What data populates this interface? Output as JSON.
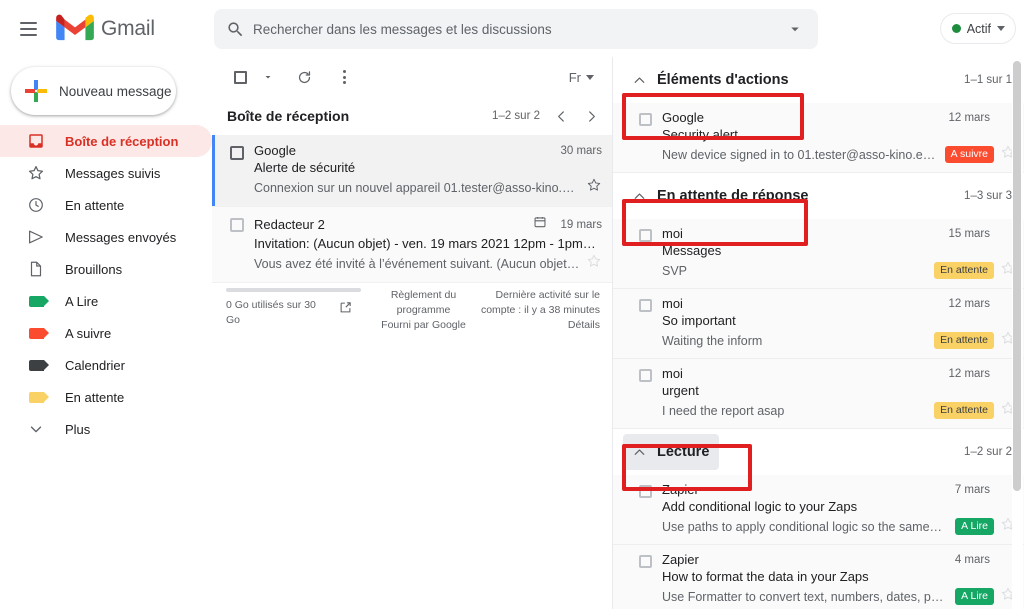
{
  "topbar": {
    "app_name": "Gmail",
    "menu_icon": "hamburger-icon",
    "logo_icon": "gmail-logo-icon",
    "search": {
      "placeholder": "Rechercher dans les messages et les discussions",
      "value": "",
      "icon": "search-icon",
      "options_icon": "chevron-down-icon"
    },
    "status": {
      "label": "Actif",
      "dot_color": "#1e8e3e",
      "caret_icon": "chevron-down-icon"
    }
  },
  "sidebar": {
    "compose": {
      "label": "Nouveau message",
      "icon": "plus-icon"
    },
    "items": [
      {
        "label": "Boîte de réception",
        "icon": "inbox-icon",
        "active": true
      },
      {
        "label": "Messages suivis",
        "icon": "star-icon",
        "active": false
      },
      {
        "label": "En attente",
        "icon": "clock-icon",
        "active": false
      },
      {
        "label": "Messages envoyés",
        "icon": "send-icon",
        "active": false
      },
      {
        "label": "Brouillons",
        "icon": "draft-icon",
        "active": false
      },
      {
        "label": "A Lire",
        "icon": "label-tag-icon",
        "color": "#16a765",
        "active": false
      },
      {
        "label": "A suivre",
        "icon": "label-tag-icon",
        "color": "#fb4c2f",
        "active": false
      },
      {
        "label": "Calendrier",
        "icon": "label-tag-icon",
        "color": "#3c4043",
        "active": false
      },
      {
        "label": "En attente",
        "icon": "label-tag-icon",
        "color": "#fad165",
        "active": false
      },
      {
        "label": "Plus",
        "icon": "chevron-down-icon",
        "active": false
      }
    ]
  },
  "center": {
    "toolbar": {
      "select_all_icon": "checkbox-icon",
      "select_caret_icon": "chevron-down-icon",
      "refresh_icon": "refresh-icon",
      "more_icon": "more-vertical-icon",
      "language_label": "Fr",
      "language_caret_icon": "chevron-down-icon"
    },
    "list_header": {
      "title": "Boîte de réception",
      "count": "1–2 sur 2",
      "prev_icon": "chevron-left-icon",
      "next_icon": "chevron-right-icon"
    },
    "emails": [
      {
        "sender": "Google",
        "subject": "Alerte de sécurité",
        "snippet": "Connexion sur un nouvel appareil 01.tester@asso-kino.e…",
        "date": "30 mars",
        "selected": true,
        "has_calendar_icon": false,
        "star_icon": "star-outline-icon"
      },
      {
        "sender": "Redacteur 2",
        "subject": "Invitation: (Aucun objet) - ven. 19 mars 2021 12pm - 1pm…",
        "snippet": "Vous avez été invité à l’événement suivant. (Aucun objet)…",
        "date": "19 mars",
        "selected": false,
        "has_calendar_icon": true,
        "star_icon": "star-outline-icon"
      }
    ],
    "footer": {
      "storage_text": "0 Go utilisés sur 30 Go",
      "storage_icon": "open-in-new-icon",
      "policy_line1": "Règlement du",
      "policy_line2": "programme",
      "powered_by": "Fourni par Google",
      "activity_line1": "Dernière activité sur le",
      "activity_line2": "compte : il y a 38 minutes",
      "details_link": "Détails"
    }
  },
  "right_panel": {
    "highlight_color": "#e02020",
    "sections": [
      {
        "title": "Éléments d'actions",
        "count": "1–1 sur 1",
        "chevron_icon": "chevron-up-icon",
        "highlighted": true,
        "hovered": false,
        "emails": [
          {
            "sender": "Google",
            "subject": "Security alert",
            "snippet": "New device signed in to 01.tester@asso-kino.e…",
            "date": "12 mars",
            "badge": {
              "label": "A suivre",
              "color": "#fb4c2f"
            },
            "star_icon": "star-outline-icon"
          }
        ]
      },
      {
        "title": "En attente de réponse",
        "count": "1–3 sur 3",
        "chevron_icon": "chevron-up-icon",
        "highlighted": true,
        "hovered": false,
        "emails": [
          {
            "sender": "moi",
            "subject": "Messages",
            "snippet": "SVP",
            "date": "15 mars",
            "badge": {
              "label": "En attente",
              "color": "#fad165"
            },
            "star_icon": "star-outline-icon"
          },
          {
            "sender": "moi",
            "subject": "So important",
            "snippet": "Waiting the inform",
            "date": "12 mars",
            "badge": {
              "label": "En attente",
              "color": "#fad165"
            },
            "star_icon": "star-outline-icon"
          },
          {
            "sender": "moi",
            "subject": "urgent",
            "snippet": "I need the report asap",
            "date": "12 mars",
            "badge": {
              "label": "En attente",
              "color": "#fad165"
            },
            "star_icon": "star-outline-icon"
          }
        ]
      },
      {
        "title": "Lecture",
        "count": "1–2 sur 2",
        "chevron_icon": "chevron-up-icon",
        "highlighted": true,
        "hovered": true,
        "emails": [
          {
            "sender": "Zapier",
            "subject": "Add conditional logic to your Zaps",
            "snippet": "Use paths to apply conditional logic so the same…",
            "date": "7 mars",
            "badge": {
              "label": "A Lire",
              "color": "#16a765"
            },
            "star_icon": "star-outline-icon"
          },
          {
            "sender": "Zapier",
            "subject": "How to format the data in your Zaps",
            "snippet": "Use Formatter to convert text, numbers, dates, p…",
            "date": "4 mars",
            "badge": {
              "label": "A Lire",
              "color": "#16a765"
            },
            "star_icon": "star-outline-icon"
          }
        ]
      }
    ],
    "scrollbar_icon": "vertical-scrollbar"
  }
}
